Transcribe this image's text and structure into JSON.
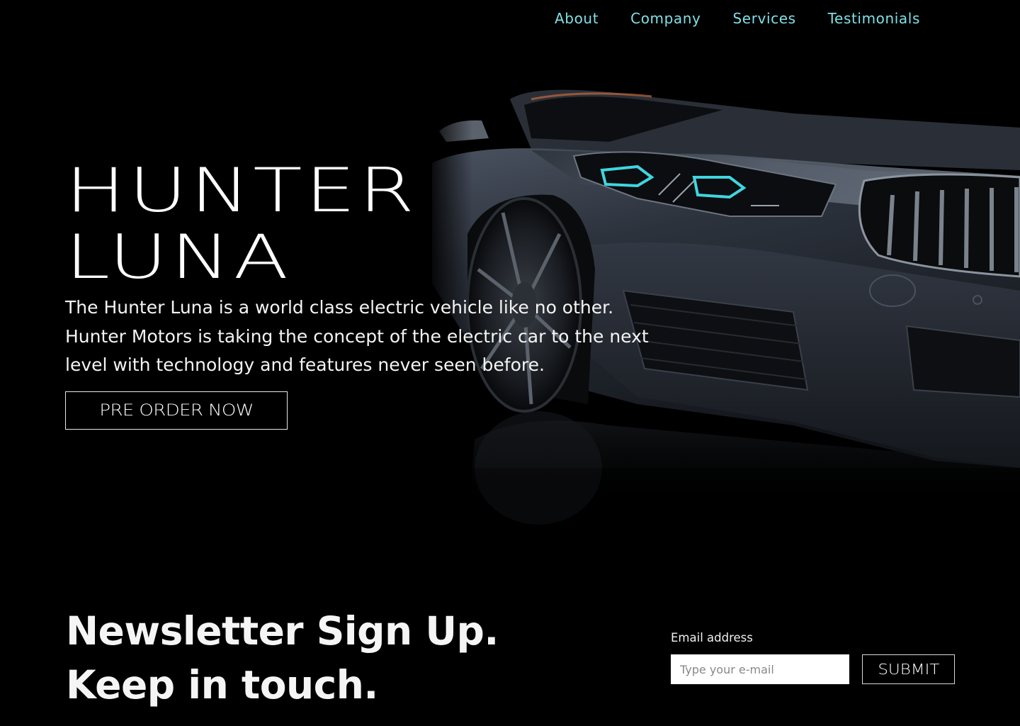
{
  "nav": {
    "items": [
      {
        "label": "About"
      },
      {
        "label": "Company"
      },
      {
        "label": "Services"
      },
      {
        "label": "Testimonials"
      }
    ]
  },
  "hero": {
    "title_line1": "HUNTER",
    "title_line2": "LUNA",
    "description": "The Hunter Luna is a world class electric vehicle like no other. Hunter Motors is taking the concept of the electric car to the next level with technology and features never seen before.",
    "cta_label": "PRE ORDER NOW",
    "image": "dark-sports-car"
  },
  "newsletter": {
    "title_line1": "Newsletter Sign Up.",
    "title_line2": "Keep in touch.",
    "email_label": "Email address",
    "email_placeholder": "Type your e-mail",
    "email_value": "",
    "submit_label": "SUBMIT"
  },
  "colors": {
    "background": "#000000",
    "nav_link": "#7fe0e6",
    "text": "#f2f2f2",
    "headlight_accent": "#3fd6e0"
  }
}
